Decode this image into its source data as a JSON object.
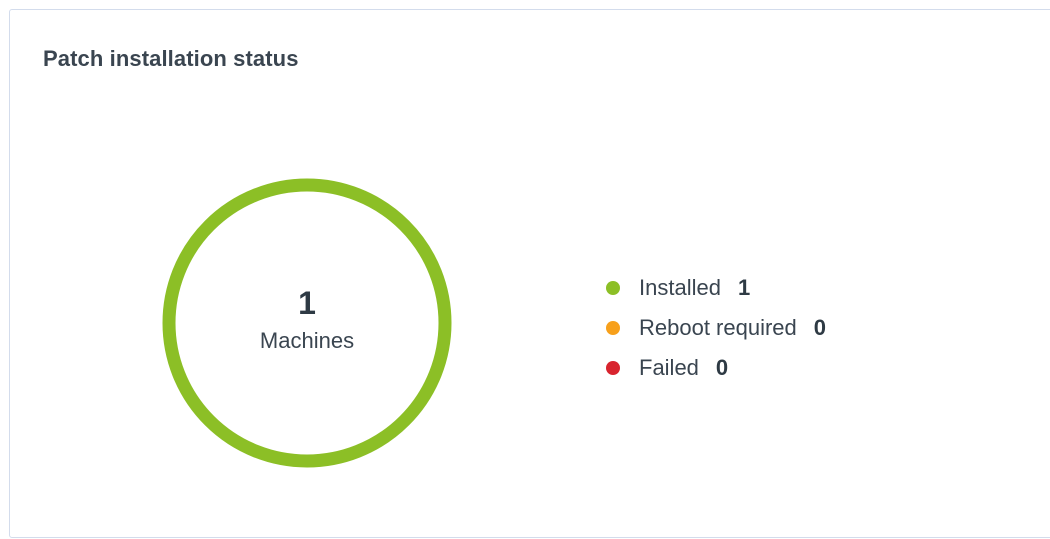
{
  "widget": {
    "title": "Patch installation status"
  },
  "chart_data": {
    "type": "pie",
    "center_value": "1",
    "center_label": "Machines",
    "series": [
      {
        "name": "Installed",
        "value": 1,
        "color": "#8cbf26"
      },
      {
        "name": "Reboot required",
        "value": 0,
        "color": "#f7a01b"
      },
      {
        "name": "Failed",
        "value": 0,
        "color": "#d8242e"
      }
    ]
  },
  "legend": {
    "items": [
      {
        "label": "Installed",
        "count": "1",
        "color": "#8cbf26",
        "icon": "installed-dot-icon"
      },
      {
        "label": "Reboot required",
        "count": "0",
        "color": "#f7a01b",
        "icon": "reboot-required-dot-icon"
      },
      {
        "label": "Failed",
        "count": "0",
        "color": "#d8242e",
        "icon": "failed-dot-icon"
      }
    ]
  }
}
